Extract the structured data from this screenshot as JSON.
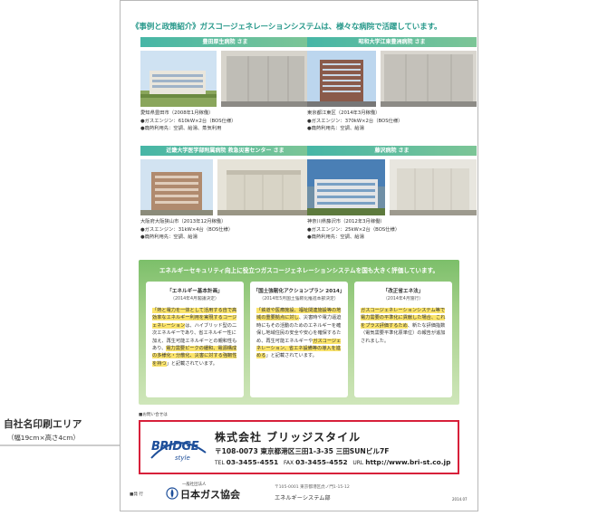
{
  "outside": {
    "label": "自社名印刷エリア",
    "size_note": "（幅19cm×高さ4cm）"
  },
  "headline": "《事例と政策紹介》ガスコージェネレーションシステムは、様々な病院で活躍しています。",
  "cases": [
    {
      "name": "豊田厚生病院 さま",
      "location": "愛知県豊田市（2008年1月稼働）",
      "engine": "●ガスエンジン：610kW×2台（BOS仕様）",
      "heat_use": "●廃熱利用先：空調、給湯、蒸気利用"
    },
    {
      "name": "昭和大学江東豊洲病院 さま",
      "location": "東京都江東区（2014年3月稼働）",
      "engine": "●ガスエンジン：370kW×2台（BOS仕様）",
      "heat_use": "●廃熱利用先：空調、給湯"
    },
    {
      "name": "近畿大学医学部附属病院 救急災害センター さま",
      "location": "大阪府大阪狭山市（2013年12月稼働）",
      "engine": "●ガスエンジン：31kW×4台（BOS仕様）",
      "heat_use": "●廃熱利用先：空調、給湯"
    },
    {
      "name": "藤沢病院 さま",
      "location": "神奈川県藤沢市（2012年3月稼働）",
      "engine": "●ガスエンジン：25kW×2台（BOS仕様）",
      "heat_use": "●廃熱利用先：空調、給湯"
    }
  ],
  "policy": {
    "title": "エネルギーセキュリティ向上に役立つガスコージェネレーションシステムを国も大きく評価しています。",
    "columns": [
      {
        "title": "「エネルギー基本計画」",
        "sub": "（2014年4月閣議決定）",
        "p1": "「熱と電力を一体として活用する自で高効率なエネルギー利用を実現するコージェネレーション",
        "p2": "は、ハイブリッド型の二次エネルギーであり、省エネルギー性に加え、再生可能エネルギーとの親和性もあり、",
        "p3": "電力需要ピークの緩和、電源構成の多様化・分散化、災害に対する強靭性を持つ",
        "p4": "」と記載されています。"
      },
      {
        "title": "「国土強靭化アクションプラン 2014」",
        "sub": "（2014年5月国土強靭化推進本部決定）",
        "p1": "「鉄道や医療施設、福祉関連施設等の地域の重要拠点に対し",
        "p2": "、災害時や電力逼迫時にもその活動のためのエネルギーを確保し地域住民の安全や安心を確保するため、再生可能エネルギーや",
        "p3": "ガスコージェネレーション、省エネ設備等の導入を進める",
        "p4": "」と記載されています。"
      },
      {
        "title": "「改正省エネ法」",
        "sub": "（2014年4月施行）",
        "p1": "ガスコージェネレーションシステム等で電力需要の平準化に貢献した場合、これをプラス評価するため",
        "p2": "、新たな評価指数（電気需要平準化原単位）の報告が追加されました。",
        "p3": "",
        "p4": ""
      }
    ]
  },
  "contact_label": "■お問い合せは",
  "company": {
    "logo_main": "BRIDGE",
    "logo_sub": "style",
    "name": "株式会社 ブリッジスタイル",
    "address": "〒108-0073 東京都港区三田1-3-35 三田SUNビル7F",
    "tel_label": "TEL",
    "tel": "03-3455-4551",
    "fax_label": "FAX",
    "fax": "03-3455-4552",
    "url_label": "URL",
    "url": "http://www.bri-st.co.jp"
  },
  "issuer": {
    "label": "■発 行",
    "sub": "一般社団法人",
    "name": "日本ガス協会",
    "address": "〒105-0001 東京都港区虎ノ門1-15-12",
    "dept": "エネルギーシステム部",
    "code": "2014.07"
  }
}
